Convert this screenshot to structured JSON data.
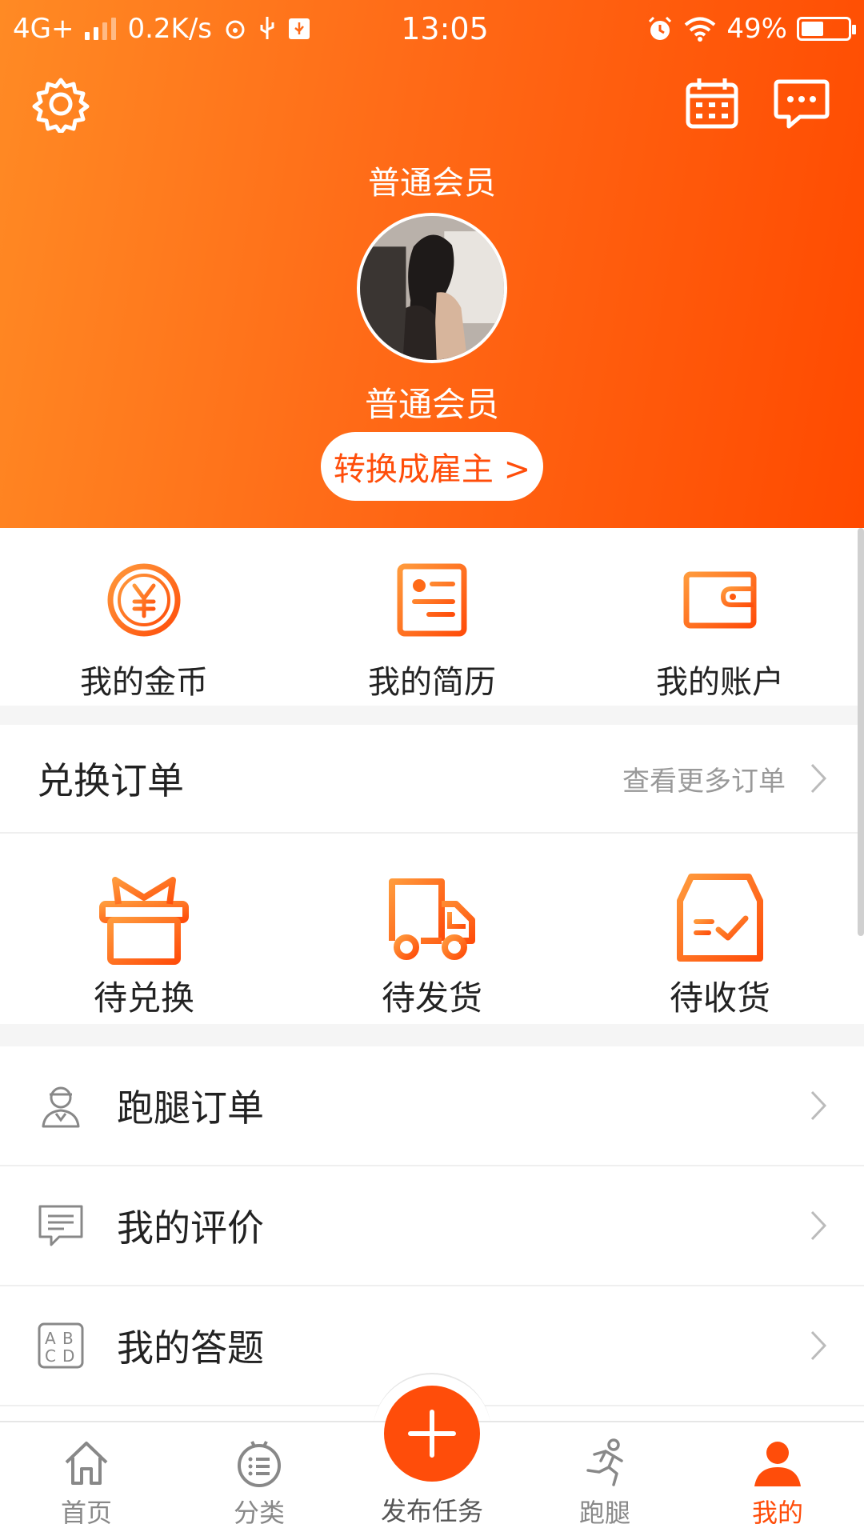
{
  "status_bar": {
    "network": "4G+",
    "speed": "0.2K/s",
    "time": "13:05",
    "battery": "49%",
    "battery_level": 0.49
  },
  "header": {
    "member_level_top": "普通会员",
    "member_level_bottom": "普通会员",
    "switch_button": "转换成雇主 >"
  },
  "quick_actions": [
    {
      "label": "我的金币",
      "icon": "coin-icon"
    },
    {
      "label": "我的简历",
      "icon": "resume-icon"
    },
    {
      "label": "我的账户",
      "icon": "wallet-icon"
    }
  ],
  "exchange_orders": {
    "title": "兑换订单",
    "more_link": "查看更多订单",
    "items": [
      {
        "label": "待兑换",
        "icon": "gift-icon"
      },
      {
        "label": "待发货",
        "icon": "truck-icon"
      },
      {
        "label": "待收货",
        "icon": "box-check-icon"
      }
    ]
  },
  "menu": [
    {
      "label": "跑腿订单",
      "icon": "courier-icon"
    },
    {
      "label": "我的评价",
      "icon": "comment-icon"
    },
    {
      "label": "我的答题",
      "icon": "abcd-icon"
    }
  ],
  "tab_bar": {
    "items": [
      {
        "label": "首页",
        "icon": "home-icon"
      },
      {
        "label": "分类",
        "icon": "category-icon"
      },
      {
        "label": "发布任务",
        "icon": "plus-icon"
      },
      {
        "label": "跑腿",
        "icon": "runner-icon"
      },
      {
        "label": "我的",
        "icon": "user-icon"
      }
    ],
    "active": "我的"
  },
  "colors": {
    "accent": "#ff4d0a",
    "gradient_start": "#ff8a24",
    "gradient_end": "#ff4a00"
  }
}
